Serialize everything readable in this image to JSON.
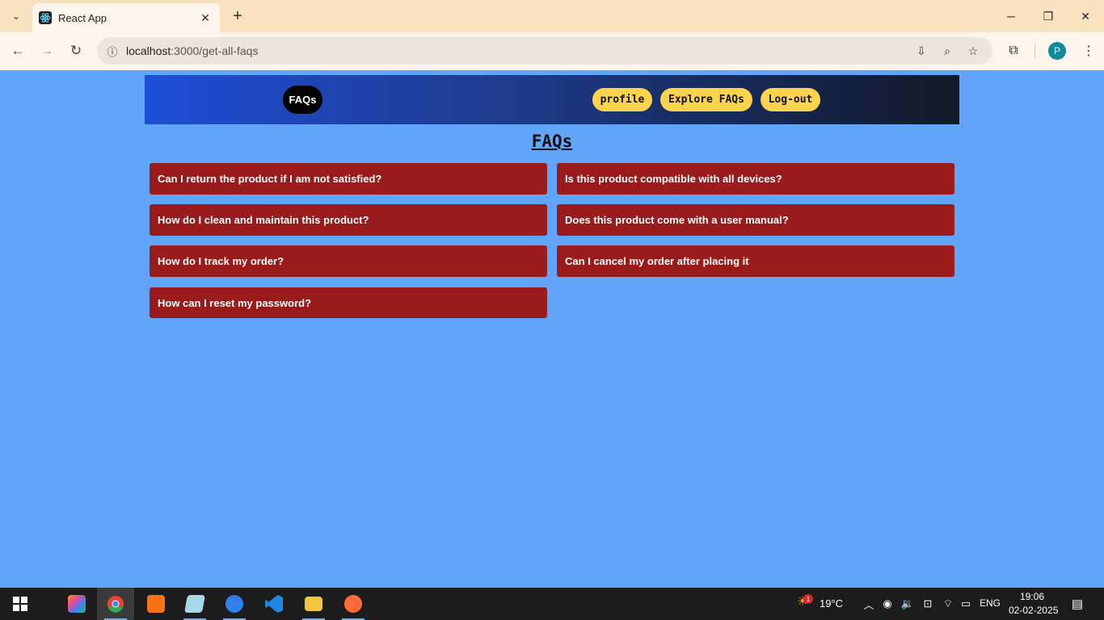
{
  "browser": {
    "tab_title": "React App",
    "url_host": "localhost",
    "url_rest": ":3000/get-all-faqs",
    "profile_initial": "P"
  },
  "navbar": {
    "brand": "FAQs",
    "links": [
      "profile",
      "Explore FAQs",
      "Log-out"
    ]
  },
  "page_title": "FAQs",
  "faqs": [
    "Can I return the product if I am not satisfied?",
    "Is this product compatible with all devices?",
    "How do I clean and maintain this product?",
    "Does this product come with a user manual?",
    "How do I track my order?",
    "Can I cancel my order after placing it",
    "How can I reset my password?"
  ],
  "taskbar": {
    "weather_temp": "19°C",
    "weather_badge": "1",
    "language": "ENG",
    "time": "19:06",
    "date": "02-02-2025"
  },
  "colors": {
    "page_bg": "#60a5fa",
    "faq_card": "#991b1b",
    "nav_pill": "#fcd34d"
  }
}
